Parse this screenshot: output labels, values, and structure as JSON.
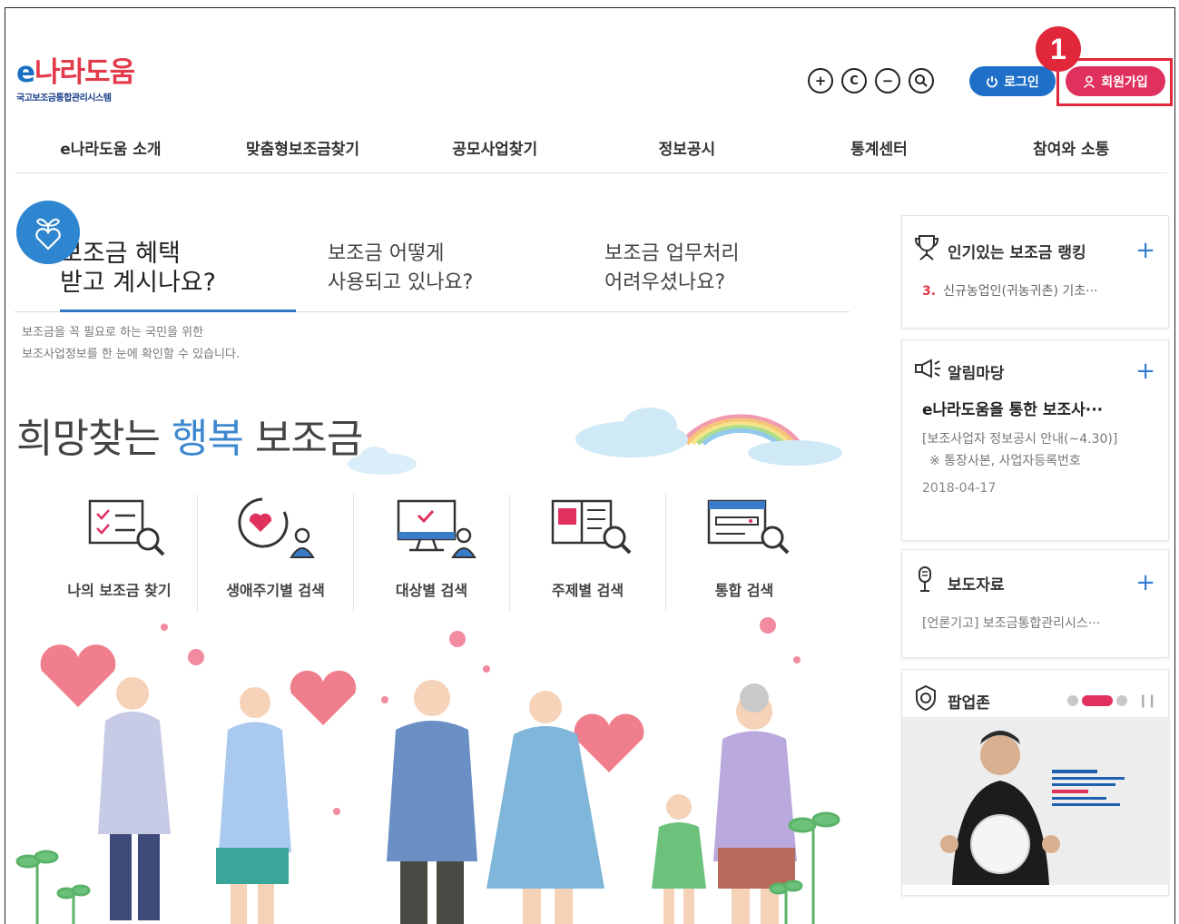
{
  "header": {
    "logo_main_e": "e",
    "logo_main_rest": "나라도움",
    "logo_sub": "국고보조금통합관리시스템",
    "util_icons": [
      "zoom-in-icon",
      "reset-icon",
      "zoom-out-icon",
      "search-icon"
    ],
    "login_label": "로그인",
    "join_label": "회원가입",
    "callout_number": "1"
  },
  "gnb": {
    "items": [
      "e나라도움 소개",
      "맞춤형보조금찾기",
      "공모사업찾기",
      "정보공시",
      "통계센터",
      "참여와 소통"
    ]
  },
  "main": {
    "tabs": [
      {
        "line1": "보조금 혜택",
        "line2": "받고 계시나요?"
      },
      {
        "line1": "보조금 어떻게",
        "line2": "사용되고 있나요?"
      },
      {
        "line1": "보조금 업무처리",
        "line2": "어려우셨나요?"
      }
    ],
    "desc_line1": "보조금을 꼭 필요로 하는 국민을 위한",
    "desc_line2": "보조사업정보를 한 눈에 확인할 수 있습니다.",
    "hero_part1": "희망찾는",
    "hero_highlight": "행복",
    "hero_part2": "보조금",
    "search_items": [
      {
        "label": "나의 보조금 찾기"
      },
      {
        "label": "생애주기별 검색"
      },
      {
        "label": "대상별 검색"
      },
      {
        "label": "주제별 검색"
      },
      {
        "label": "통합 검색"
      }
    ]
  },
  "sidebar": {
    "ranking": {
      "title": "인기있는 보조금 랭킹",
      "item_num": "3.",
      "item_text": "신규농업인(귀농귀촌) 기초···"
    },
    "notice": {
      "title": "알림마당",
      "headline": "e나라도움을 통한 보조사···",
      "body_line1": "[보조사업자 정보공시 안내(~4.30)]",
      "body_line2": "※ 통장사본, 사업자등록번호",
      "date": "2018-04-17"
    },
    "press": {
      "title": "보도자료",
      "item": "[언론기고] 보조금통합관리시스···"
    },
    "popup": {
      "title": "팝업존"
    }
  },
  "colors": {
    "brand_blue": "#1e6fc7",
    "brand_red": "#e0315e",
    "callout_red": "#e0283a",
    "highlight_blue": "#3d88d0"
  }
}
